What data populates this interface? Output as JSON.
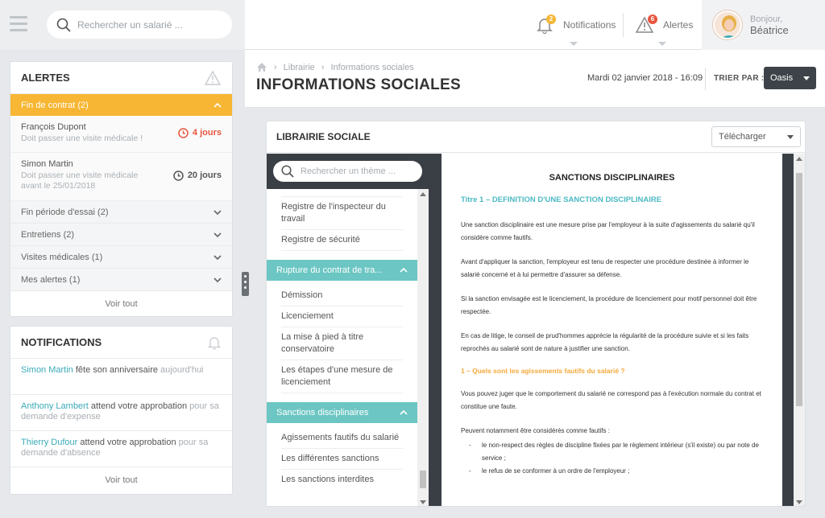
{
  "topbar": {
    "search_placeholder": "Rechercher un salarié ...",
    "notifications_label": "Notifications",
    "notifications_count": "2",
    "alerts_label": "Alertes",
    "alerts_count": "6",
    "greeting": "Bonjour,",
    "user_name": "Béatrice"
  },
  "alerts_card": {
    "title": "ALERTES",
    "open_group": "Fin de contrat (2)",
    "items": [
      {
        "name": "François Dupont",
        "desc": "Doit passer une visite médicale !",
        "days": "4 jours",
        "color": "#e8553f"
      },
      {
        "name": "Simon Martin",
        "desc": "Doit passer une visite médicale avant le 25/01/2018",
        "days": "20 jours",
        "color": "#555555"
      }
    ],
    "groups": [
      "Fin période d'essai (2)",
      "Entretiens (2)",
      "Visites médicales (1)",
      "Mes alertes (1)"
    ],
    "see_all": "Voir tout"
  },
  "notifications_card": {
    "title": "NOTIFICATIONS",
    "items": [
      {
        "who": "Simon Martin",
        "action": " fête son anniversaire",
        "rest": " aujourd'hui"
      },
      {
        "who": "Anthony Lambert",
        "action": " attend votre approbation",
        "rest": " pour sa demande d'expense"
      },
      {
        "who": "Thierry Dufour",
        "action": " attend votre approbation",
        "rest": " pour sa demande d'absence"
      }
    ],
    "see_all": "Voir tout"
  },
  "header": {
    "breadcrumb": [
      "Librairie",
      "Informations sociales"
    ],
    "title": "INFORMATIONS SOCIALES",
    "datetime": "Mardi 02 janvier 2018 - 16:09",
    "sort_label": "TRIER PAR :",
    "sort_value": "Oasis"
  },
  "library": {
    "title": "LIBRAIRIE SOCIALE",
    "download": "Télécharger",
    "search_placeholder": "Rechercher un thème ...",
    "items_top": [
      "Registre de l'inspecteur du travail",
      "Registre de sécurité"
    ],
    "section1": "Rupture du contrat de tra...",
    "items_section1": [
      "Démission",
      "Licenciement",
      "La mise à pied à titre conservatoire",
      "Les étapes d'une mesure de licenciement"
    ],
    "section2": "Sanctions disciplinaires",
    "items_section2": [
      "Agissements fautifs du salarié",
      "Les différentes sanctions",
      "Les sanctions interdites"
    ]
  },
  "document": {
    "title": "SANCTIONS DISCIPLINAIRES",
    "heading1": "Titre 1 – DEFINITION D'UNE SANCTION DISCIPLINAIRE",
    "p1": "Une sanction disciplinaire est une mesure prise par l'employeur à la suite d'agissements du salarié qu'il considère comme fautifs.",
    "p2": "Avant d'appliquer la sanction, l'employeur est tenu de respecter une procédure destinée à informer le salarié concerné et à lui permettre d'assurer sa défense.",
    "p3": "Si la sanction envisagée est le licenciement, la procédure de licenciement pour motif personnel doit être respectée.",
    "p4": "En cas de litige, le conseil de prud'hommes apprécie la régularité de la procédure suivie et si les faits reprochés au salarié sont de nature à justifier une sanction.",
    "heading2": "1 – Quels sont les agissements fautifs du salarié ?",
    "p5": "Vous pouvez juger que le comportement du salarié ne correspond pas à l'exécution normale du contrat et constitue une faute.",
    "p6": "Peuvent notamment être considérés comme fautifs :",
    "list": [
      "le non-respect des règles de discipline fixées par le règlement intérieur (s'il existe) ou par note de service ;",
      "le refus de se conformer à un ordre de l'employeur ;"
    ]
  }
}
